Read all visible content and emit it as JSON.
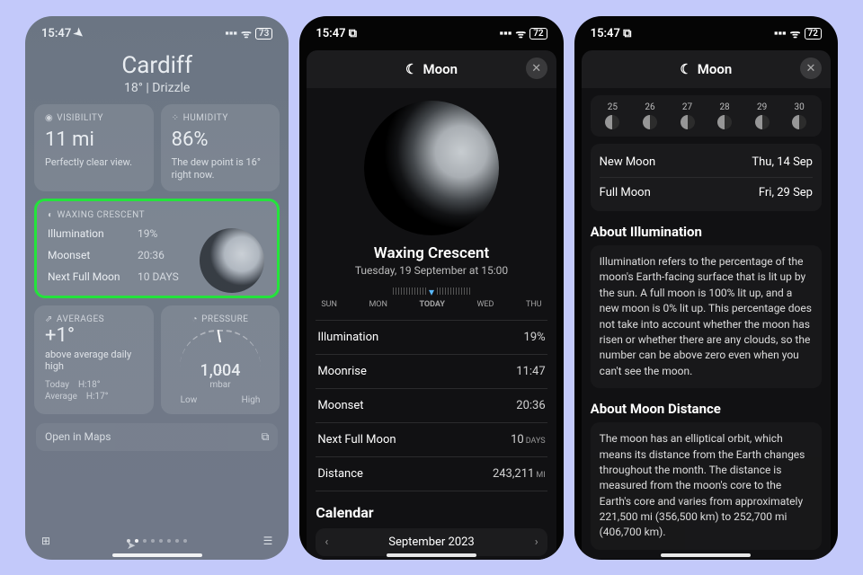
{
  "status": {
    "time": "15:47",
    "battery": "73",
    "battery2": "72"
  },
  "left": {
    "city": "Cardiff",
    "cond": "18°  |  Drizzle",
    "visibility": {
      "label": "VISIBILITY",
      "value": "11 mi",
      "sub": "Perfectly clear view."
    },
    "humidity": {
      "label": "HUMIDITY",
      "value": "86%",
      "sub": "The dew point is 16° right now."
    },
    "moon": {
      "label": "WAXING CRESCENT",
      "rows": [
        {
          "k": "Illumination",
          "v": "19%"
        },
        {
          "k": "Moonset",
          "v": "20:36"
        },
        {
          "k": "Next Full Moon",
          "v": "10 DAYS"
        }
      ]
    },
    "averages": {
      "label": "AVERAGES",
      "temp": "+1°",
      "desc": "above average daily high",
      "today": {
        "k": "Today",
        "h": "H:18°"
      },
      "avg": {
        "k": "Average",
        "h": "H:17°"
      }
    },
    "pressure": {
      "label": "PRESSURE",
      "value": "1,004",
      "unit": "mbar",
      "low": "Low",
      "high": "High"
    },
    "open_maps": "Open in Maps"
  },
  "mid": {
    "title": "Moon",
    "phase": "Waxing Crescent",
    "phase_sub": "Tuesday, 19 September at 15:00",
    "days": [
      "SUN",
      "MON",
      "TODAY",
      "WED",
      "THU"
    ],
    "rows": [
      {
        "k": "Illumination",
        "v": "19%"
      },
      {
        "k": "Moonrise",
        "v": "11:47"
      },
      {
        "k": "Moonset",
        "v": "20:36"
      },
      {
        "k": "Next Full Moon",
        "v": "10",
        "unit": "DAYS"
      },
      {
        "k": "Distance",
        "v": "243,211",
        "unit": "MI"
      }
    ],
    "cal_title": "Calendar",
    "cal_month": "September 2023"
  },
  "right": {
    "title": "Moon",
    "cal_days": [
      "25",
      "26",
      "27",
      "28",
      "29",
      "30"
    ],
    "events": [
      {
        "k": "New Moon",
        "v": "Thu, 14 Sep"
      },
      {
        "k": "Full Moon",
        "v": "Fri, 29 Sep"
      }
    ],
    "illum_title": "About Illumination",
    "illum_body": "Illumination refers to the percentage of the moon's Earth-facing surface that is lit up by the sun. A full moon is 100% lit up, and a new moon is 0% lit up. This percentage does not take into account whether the moon has risen or whether there are any clouds, so the number can be above zero even when you can't see the moon.",
    "dist_title": "About Moon Distance",
    "dist_body": "The moon has an elliptical orbit, which means its distance from the Earth changes throughout the month. The distance is measured from the moon's core to the Earth's core and varies from approximately 221,500 mi (356,500 km) to 252,700 mi (406,700 km)."
  }
}
